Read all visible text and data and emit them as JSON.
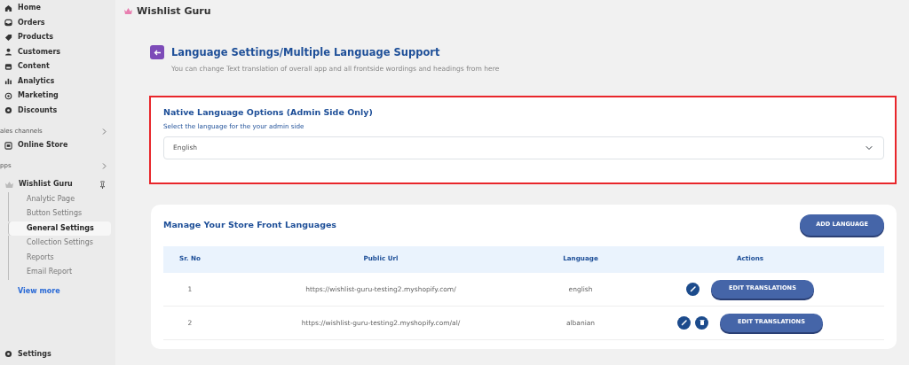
{
  "sidebar": {
    "items": [
      {
        "kind": "nav",
        "label": "Home"
      },
      {
        "kind": "nav",
        "label": "Orders"
      },
      {
        "kind": "nav",
        "label": "Products"
      },
      {
        "kind": "nav",
        "label": "Customers"
      },
      {
        "kind": "nav",
        "label": "Content"
      },
      {
        "kind": "nav",
        "label": "Analytics"
      },
      {
        "kind": "nav",
        "label": "Marketing"
      },
      {
        "kind": "nav",
        "label": "Discounts"
      },
      {
        "kind": "section",
        "label": "ales channels"
      },
      {
        "kind": "nav",
        "label": "Online Store"
      },
      {
        "kind": "section",
        "label": "pps"
      },
      {
        "kind": "app",
        "label": "Wishlist Guru"
      },
      {
        "kind": "sub",
        "label": "Analytic Page",
        "selected": false
      },
      {
        "kind": "sub",
        "label": "Button Settings",
        "selected": false
      },
      {
        "kind": "sub",
        "label": "General Settings",
        "selected": true
      },
      {
        "kind": "sub",
        "label": "Collection Settings",
        "selected": false
      },
      {
        "kind": "sub",
        "label": "Reports",
        "selected": false
      },
      {
        "kind": "sub",
        "label": "Email Report",
        "selected": false
      },
      {
        "kind": "link",
        "label": "View more"
      }
    ],
    "footer": "Settings"
  },
  "header": {
    "title": "Wishlist Guru"
  },
  "page": {
    "title": "Language Settings/Multiple Language Support",
    "subtitle": "You can change Text translation of overall app and all frontside wordings and headings from here"
  },
  "native_card": {
    "title": "Native Language Options (Admin Side Only)",
    "label": "Select the language for the your admin side",
    "value": "English",
    "highlighted": true
  },
  "store_card": {
    "title": "Manage Your Store Front Languages",
    "add_button": "ADD LANGUAGE",
    "table": {
      "columns": [
        "Sr. No",
        "Public Url",
        "Language",
        "Actions"
      ],
      "rows": [
        {
          "no": "1",
          "url": "https://wishlist-guru-testing2.myshopify.com/",
          "language": "english",
          "deletable": false,
          "button": "EDIT TRANSLATIONS"
        },
        {
          "no": "2",
          "url": "https://wishlist-guru-testing2.myshopify.com/al/",
          "language": "albanian",
          "deletable": true,
          "button": "EDIT TRANSLATIONS"
        }
      ]
    }
  }
}
